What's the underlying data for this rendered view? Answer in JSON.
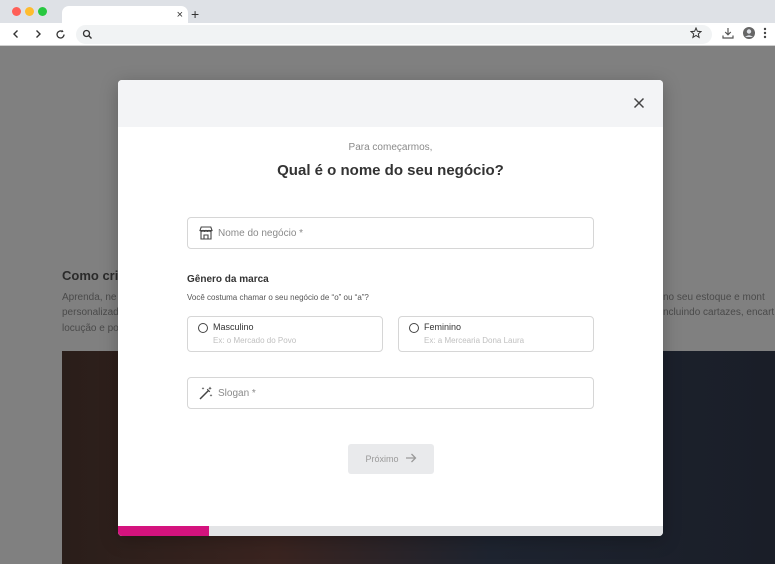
{
  "browser": {
    "tab_close": "×",
    "new_tab": "+"
  },
  "background_page": {
    "heading": "Como cria",
    "lines": [
      "Aprenda, ne",
      "personalizad",
      "locução e po"
    ],
    "right_lines": [
      "no seu estoque e mont",
      "ncluindo cartazes, encart"
    ]
  },
  "modal": {
    "subtitle": "Para começarmos,",
    "title": "Qual é o nome do seu negócio?",
    "business_name": {
      "placeholder": "Nome do negócio *",
      "value": ""
    },
    "gender": {
      "label": "Gênero da marca",
      "help": "Você costuma chamar o seu negócio de “o” ou “a”?",
      "options": [
        {
          "label": "Masculino",
          "hint": "Ex: o Mercado do Povo"
        },
        {
          "label": "Feminino",
          "hint": "Ex: a Mercearia Dona Laura"
        }
      ]
    },
    "slogan": {
      "placeholder": "Slogan *",
      "value": ""
    },
    "next_label": "Próximo",
    "progress": 0.167
  },
  "colors": {
    "accent": "#d4137e",
    "backdrop": "#808080"
  },
  "icons": {
    "close": "close-icon",
    "store": "store-icon",
    "magic_wand": "magic-wand-icon",
    "arrow_right": "arrow-right-icon"
  }
}
